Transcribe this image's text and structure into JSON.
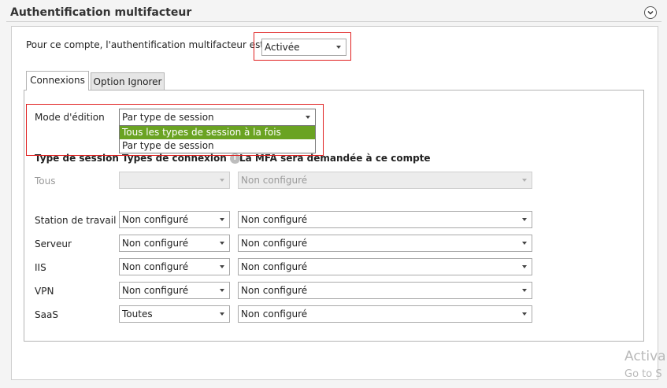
{
  "header": {
    "title": "Authentification multifacteur",
    "collapse_icon": "chevron-down-circle-icon"
  },
  "mfa": {
    "label": "Pour ce compte, l'authentification multifacteur est",
    "value": "Activée"
  },
  "tabs": [
    {
      "label": "Connexions",
      "active": true
    },
    {
      "label": "Option Ignorer",
      "active": false
    }
  ],
  "edit_mode": {
    "label": "Mode d'édition",
    "value": "Par type de session",
    "options": [
      {
        "label": "Tous les types de session à la fois",
        "highlighted": true
      },
      {
        "label": "Par type de session",
        "highlighted": false
      }
    ]
  },
  "columns": {
    "session_type": "Type de session",
    "connection_types": "Types de connexion",
    "mfa_required": "La MFA sera demandée à ce compte",
    "info_icon": "info-icon"
  },
  "rows": [
    {
      "label": "Tous",
      "connection": "",
      "mfa": "Non configuré",
      "disabled": true
    },
    {
      "label": "Station de travail",
      "connection": "Non configuré",
      "mfa": "Non configuré",
      "disabled": false
    },
    {
      "label": "Serveur",
      "connection": "Non configuré",
      "mfa": "Non configuré",
      "disabled": false
    },
    {
      "label": "IIS",
      "connection": "Non configuré",
      "mfa": "Non configuré",
      "disabled": false
    },
    {
      "label": "VPN",
      "connection": "Non configuré",
      "mfa": "Non configuré",
      "disabled": false
    },
    {
      "label": "SaaS",
      "connection": "Toutes",
      "mfa": "Non configuré",
      "disabled": false
    }
  ],
  "watermark": {
    "line1": "Activa",
    "line2": "Go to S"
  },
  "colors": {
    "highlight": "#6aa322",
    "annotation_red": "#e02020"
  }
}
